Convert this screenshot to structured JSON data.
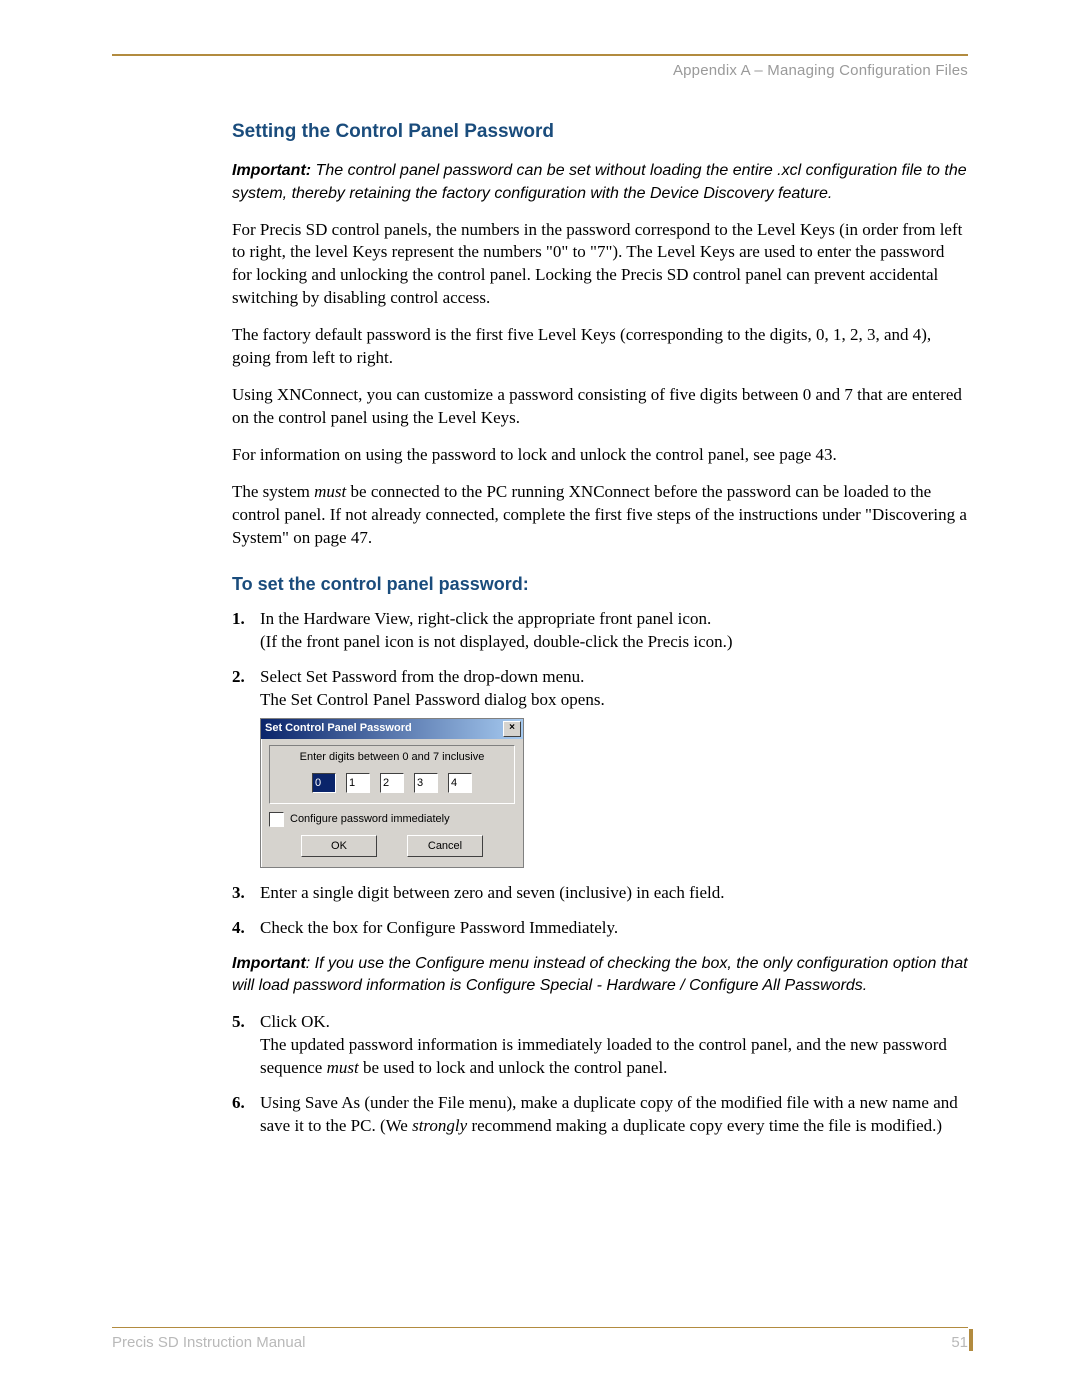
{
  "header": {
    "running_head": "Appendix A – Managing Configuration Files"
  },
  "section_title": "Setting the Control Panel Password",
  "important1": {
    "label": "Important:",
    "text": " The control panel password can be set without loading the entire .xcl configuration file to the system, thereby retaining the factory configuration with the Device Discovery feature."
  },
  "paragraphs": {
    "p1": "For Precis SD control panels, the numbers in the password correspond to the Level Keys (in order from left to right, the level Keys represent the numbers \"0\" to \"7\"). The Level Keys are used to enter the password for locking and unlocking the control panel. Locking the Precis SD control panel can prevent accidental switching by disabling control access.",
    "p2": "The factory default password is the first five Level Keys (corresponding to the digits, 0, 1, 2, 3, and 4), going from left to right.",
    "p3": "Using XNConnect, you can customize a password consisting of five digits between 0 and 7 that are entered on the control panel using the Level Keys.",
    "p4": "For information on using the password to lock and unlock the control panel, see page 43.",
    "p5a": "The system ",
    "p5b": "must",
    "p5c": " be connected to the PC running XNConnect before the password can be loaded to the control panel. If not already connected, complete the first five steps of the instructions under \"Discovering a System\" on page 47."
  },
  "subsection_title": "To set the control panel password:",
  "steps": {
    "s1a": "In the Hardware View, right-click the appropriate front panel icon.",
    "s1b": "(If the front panel icon is not displayed, double-click the Precis icon.)",
    "s2a": "Select Set Password from the drop-down menu.",
    "s2b": "The Set Control Panel Password dialog box opens.",
    "s3": "Enter a single digit between zero and seven (inclusive) in each field.",
    "s4": "Check the box for Configure Password Immediately.",
    "s5a": "Click OK.",
    "s5b": "The updated password information is immediately loaded to the control panel, and the new password sequence ",
    "s5c": "must",
    "s5d": " be used to lock and unlock the control panel.",
    "s6a": "Using Save As (under the File menu), make a duplicate copy of the modified file with a new name and save it to the PC. (We ",
    "s6b": "strongly",
    "s6c": " recommend making a duplicate copy every time the file is modified.)"
  },
  "important2": {
    "label": "Important",
    "text": ": If you use the Configure menu instead of checking the box, the only configuration option that will load password information is Configure Special - Hardware / Configure All Passwords."
  },
  "dialog": {
    "title": "Set Control Panel Password",
    "close_glyph": "×",
    "group_label": "Enter digits between 0 and 7 inclusive",
    "digits": [
      "0",
      "1",
      "2",
      "3",
      "4"
    ],
    "checkbox_label": "Configure password immediately",
    "ok": "OK",
    "cancel": "Cancel"
  },
  "footer": {
    "left": "Precis SD Instruction Manual",
    "page": "51"
  }
}
